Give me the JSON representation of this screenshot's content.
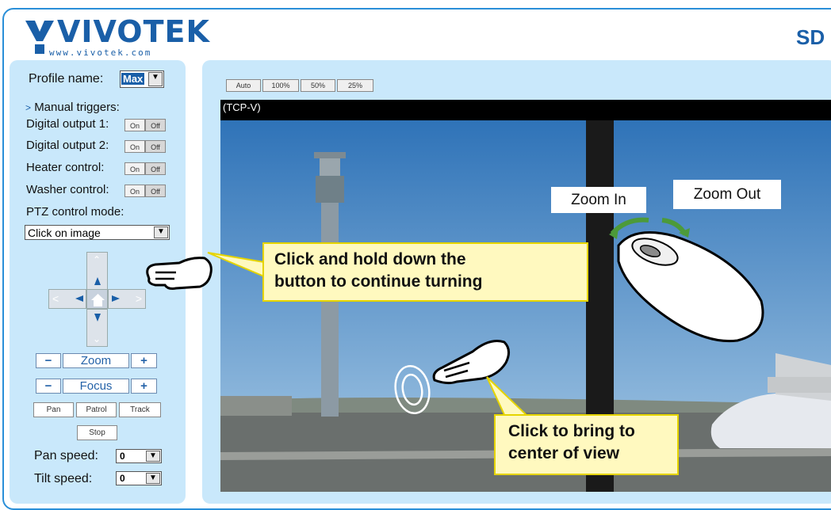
{
  "header": {
    "logo_text": "VIVOTEK",
    "logo_url": "www.vivotek.com",
    "brand_right": "SD"
  },
  "sidebar": {
    "profile_label": "Profile name:",
    "profile_value": "Max",
    "manual_triggers_label": "Manual triggers:",
    "triggers": [
      {
        "label": "Digital output 1:",
        "on": "On",
        "off": "Off"
      },
      {
        "label": "Digital output 2:",
        "on": "On",
        "off": "Off"
      },
      {
        "label": "Heater control:",
        "on": "On",
        "off": "Off"
      },
      {
        "label": "Washer control:",
        "on": "On",
        "off": "Off"
      }
    ],
    "ptz_mode_label": "PTZ control mode:",
    "ptz_mode_value": "Click on image",
    "zoom_label": "Zoom",
    "focus_label": "Focus",
    "minus": "−",
    "plus": "+",
    "pan_label": "Pan",
    "patrol_label": "Patrol",
    "track_label": "Track",
    "stop_label": "Stop",
    "pan_speed_label": "Pan speed:",
    "pan_speed_value": "0",
    "tilt_speed_label": "Tilt speed:",
    "tilt_speed_value": "0"
  },
  "main": {
    "size_buttons": [
      "Auto",
      "100%",
      "50%",
      "25%"
    ],
    "stream_label": "(TCP-V)"
  },
  "annotations": {
    "callout_hold_line1": "Click and hold down the",
    "callout_hold_line2": "button to continue turning",
    "callout_center_line1": "Click to bring to",
    "callout_center_line2": "center of view",
    "zoom_in": "Zoom In",
    "zoom_out": "Zoom Out"
  },
  "colors": {
    "accent": "#2a8fd8",
    "panel": "#c9e8fb",
    "callout_bg": "#fff9bf",
    "callout_border": "#e5d400"
  }
}
